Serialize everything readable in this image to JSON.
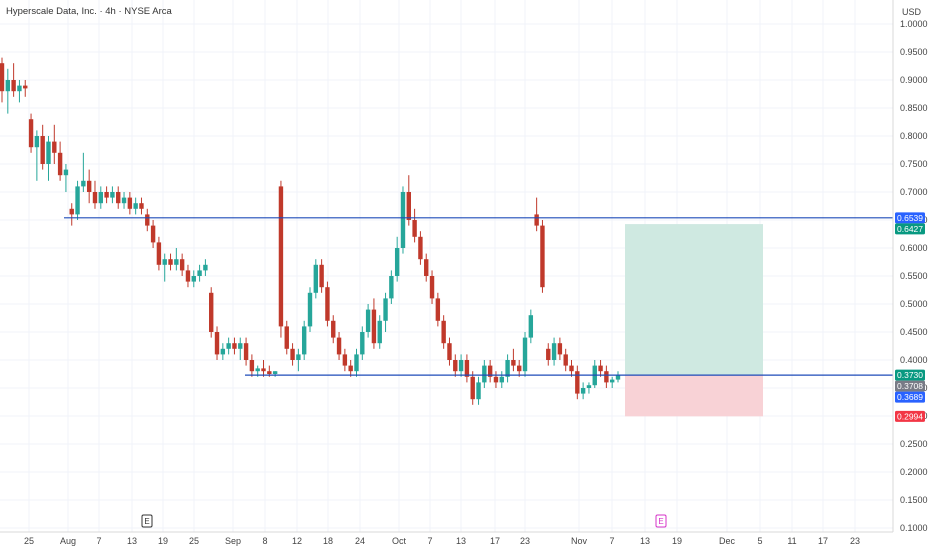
{
  "header": {
    "symbol_title": "Hyperscale Data, Inc. · 4h · NYSE Arca",
    "currency": "USD"
  },
  "colors": {
    "up": "#26a69a",
    "down": "#c0392b",
    "line": "#1e4bb8",
    "profit_zone": "#cfe9e1",
    "loss_zone": "#f8d2d6",
    "tag_green": "#089981",
    "tag_gray": "#787b86",
    "tag_blue": "#2962ff",
    "tag_red": "#f23645"
  },
  "chart_data": {
    "type": "candlestick",
    "ylim": [
      0.1,
      1.0
    ],
    "y_ticks": [
      "1.0000",
      "0.9500",
      "0.9000",
      "0.8500",
      "0.8000",
      "0.7500",
      "0.7000",
      "0.6500",
      "0.6000",
      "0.5500",
      "0.5000",
      "0.4500",
      "0.4000",
      "0.3500",
      "0.3000",
      "0.2500",
      "0.2000",
      "0.1500",
      "0.1000"
    ],
    "x_ticks": [
      "25",
      "Aug",
      "7",
      "13",
      "19",
      "25",
      "Sep",
      "8",
      "12",
      "18",
      "24",
      "Oct",
      "7",
      "13",
      "17",
      "23",
      "Nov",
      "7",
      "13",
      "19",
      "Dec",
      "5",
      "11",
      "17",
      "23"
    ],
    "horizontal_lines": [
      {
        "value": 0.6539,
        "label": "0.6539"
      },
      {
        "value": 0.373,
        "label": "0.3730"
      }
    ],
    "position": {
      "target": 0.6427,
      "entry": 0.373,
      "stop": 0.2994,
      "labels": {
        "target": "0.6427",
        "entry": "0.3730",
        "stop": "0.2994"
      }
    },
    "price_tags": [
      {
        "value": 0.6539,
        "label": "0.6539",
        "color": "tag_blue"
      },
      {
        "value": 0.6427,
        "label": "0.6427",
        "color": "tag_green"
      },
      {
        "value": 0.373,
        "label": "0.3730",
        "color": "tag_green"
      },
      {
        "value": 0.3708,
        "label": "0.3708",
        "color": "tag_gray"
      },
      {
        "value": 0.3689,
        "label": "0.3689",
        "color": "tag_blue"
      },
      {
        "value": 0.2994,
        "label": "0.2994",
        "color": "tag_red"
      }
    ],
    "events": [
      {
        "label": "E",
        "near_tick": "19",
        "style": "earnings"
      },
      {
        "label": "E",
        "near_tick": "13b",
        "style": "upcoming"
      }
    ],
    "candles": [
      [
        0.93,
        0.94,
        0.86,
        0.88
      ],
      [
        0.88,
        0.92,
        0.84,
        0.9
      ],
      [
        0.9,
        0.93,
        0.87,
        0.88
      ],
      [
        0.88,
        0.9,
        0.86,
        0.89
      ],
      [
        0.89,
        0.9,
        0.87,
        0.885
      ],
      [
        0.83,
        0.84,
        0.77,
        0.78
      ],
      [
        0.78,
        0.81,
        0.72,
        0.8
      ],
      [
        0.8,
        0.82,
        0.74,
        0.75
      ],
      [
        0.75,
        0.8,
        0.72,
        0.79
      ],
      [
        0.79,
        0.82,
        0.75,
        0.77
      ],
      [
        0.77,
        0.79,
        0.72,
        0.73
      ],
      [
        0.73,
        0.75,
        0.7,
        0.74
      ],
      [
        0.67,
        0.68,
        0.64,
        0.66
      ],
      [
        0.66,
        0.72,
        0.65,
        0.71
      ],
      [
        0.71,
        0.77,
        0.7,
        0.72
      ],
      [
        0.72,
        0.74,
        0.68,
        0.7
      ],
      [
        0.7,
        0.72,
        0.67,
        0.68
      ],
      [
        0.68,
        0.71,
        0.67,
        0.7
      ],
      [
        0.7,
        0.71,
        0.68,
        0.69
      ],
      [
        0.69,
        0.71,
        0.68,
        0.7
      ],
      [
        0.7,
        0.71,
        0.67,
        0.68
      ],
      [
        0.68,
        0.7,
        0.67,
        0.69
      ],
      [
        0.69,
        0.7,
        0.66,
        0.67
      ],
      [
        0.67,
        0.69,
        0.66,
        0.68
      ],
      [
        0.68,
        0.69,
        0.66,
        0.67
      ],
      [
        0.66,
        0.67,
        0.63,
        0.64
      ],
      [
        0.64,
        0.65,
        0.6,
        0.61
      ],
      [
        0.61,
        0.62,
        0.56,
        0.57
      ],
      [
        0.57,
        0.59,
        0.54,
        0.58
      ],
      [
        0.58,
        0.59,
        0.56,
        0.57
      ],
      [
        0.57,
        0.6,
        0.56,
        0.58
      ],
      [
        0.58,
        0.59,
        0.55,
        0.56
      ],
      [
        0.56,
        0.57,
        0.53,
        0.54
      ],
      [
        0.54,
        0.56,
        0.53,
        0.55
      ],
      [
        0.55,
        0.57,
        0.54,
        0.56
      ],
      [
        0.56,
        0.58,
        0.55,
        0.57
      ],
      [
        0.52,
        0.53,
        0.44,
        0.45
      ],
      [
        0.45,
        0.46,
        0.4,
        0.41
      ],
      [
        0.41,
        0.43,
        0.4,
        0.42
      ],
      [
        0.42,
        0.44,
        0.41,
        0.43
      ],
      [
        0.43,
        0.44,
        0.41,
        0.42
      ],
      [
        0.42,
        0.44,
        0.4,
        0.43
      ],
      [
        0.43,
        0.44,
        0.39,
        0.4
      ],
      [
        0.4,
        0.41,
        0.37,
        0.38
      ],
      [
        0.38,
        0.39,
        0.37,
        0.385
      ],
      [
        0.385,
        0.4,
        0.37,
        0.38
      ],
      [
        0.38,
        0.39,
        0.37,
        0.375
      ],
      [
        0.375,
        0.38,
        0.37,
        0.38
      ],
      [
        0.71,
        0.72,
        0.44,
        0.46
      ],
      [
        0.46,
        0.47,
        0.41,
        0.42
      ],
      [
        0.42,
        0.43,
        0.39,
        0.4
      ],
      [
        0.4,
        0.42,
        0.38,
        0.41
      ],
      [
        0.41,
        0.47,
        0.4,
        0.46
      ],
      [
        0.46,
        0.53,
        0.45,
        0.52
      ],
      [
        0.52,
        0.58,
        0.51,
        0.57
      ],
      [
        0.57,
        0.58,
        0.52,
        0.53
      ],
      [
        0.53,
        0.54,
        0.46,
        0.47
      ],
      [
        0.47,
        0.48,
        0.43,
        0.44
      ],
      [
        0.44,
        0.45,
        0.4,
        0.41
      ],
      [
        0.41,
        0.42,
        0.38,
        0.39
      ],
      [
        0.39,
        0.4,
        0.37,
        0.38
      ],
      [
        0.38,
        0.42,
        0.37,
        0.41
      ],
      [
        0.41,
        0.46,
        0.4,
        0.45
      ],
      [
        0.45,
        0.5,
        0.44,
        0.49
      ],
      [
        0.49,
        0.51,
        0.42,
        0.43
      ],
      [
        0.43,
        0.48,
        0.42,
        0.47
      ],
      [
        0.47,
        0.52,
        0.45,
        0.51
      ],
      [
        0.51,
        0.56,
        0.5,
        0.55
      ],
      [
        0.55,
        0.62,
        0.54,
        0.6
      ],
      [
        0.6,
        0.71,
        0.59,
        0.7
      ],
      [
        0.7,
        0.73,
        0.64,
        0.65
      ],
      [
        0.65,
        0.67,
        0.61,
        0.62
      ],
      [
        0.62,
        0.63,
        0.57,
        0.58
      ],
      [
        0.58,
        0.59,
        0.54,
        0.55
      ],
      [
        0.55,
        0.56,
        0.5,
        0.51
      ],
      [
        0.51,
        0.52,
        0.46,
        0.47
      ],
      [
        0.47,
        0.48,
        0.42,
        0.43
      ],
      [
        0.43,
        0.44,
        0.39,
        0.4
      ],
      [
        0.4,
        0.41,
        0.37,
        0.38
      ],
      [
        0.38,
        0.41,
        0.37,
        0.4
      ],
      [
        0.4,
        0.41,
        0.36,
        0.37
      ],
      [
        0.37,
        0.38,
        0.32,
        0.33
      ],
      [
        0.33,
        0.37,
        0.32,
        0.36
      ],
      [
        0.36,
        0.4,
        0.35,
        0.39
      ],
      [
        0.39,
        0.4,
        0.36,
        0.37
      ],
      [
        0.37,
        0.38,
        0.35,
        0.36
      ],
      [
        0.36,
        0.38,
        0.35,
        0.37
      ],
      [
        0.37,
        0.41,
        0.36,
        0.4
      ],
      [
        0.4,
        0.42,
        0.38,
        0.39
      ],
      [
        0.39,
        0.4,
        0.37,
        0.38
      ],
      [
        0.38,
        0.45,
        0.37,
        0.44
      ],
      [
        0.44,
        0.49,
        0.43,
        0.48
      ],
      [
        0.66,
        0.69,
        0.63,
        0.64
      ],
      [
        0.64,
        0.65,
        0.52,
        0.53
      ],
      [
        0.42,
        0.43,
        0.39,
        0.4
      ],
      [
        0.4,
        0.44,
        0.39,
        0.43
      ],
      [
        0.43,
        0.44,
        0.4,
        0.41
      ],
      [
        0.41,
        0.42,
        0.38,
        0.39
      ],
      [
        0.39,
        0.4,
        0.37,
        0.38
      ],
      [
        0.38,
        0.39,
        0.33,
        0.34
      ],
      [
        0.34,
        0.36,
        0.33,
        0.35
      ],
      [
        0.35,
        0.36,
        0.34,
        0.355
      ],
      [
        0.355,
        0.4,
        0.35,
        0.39
      ],
      [
        0.39,
        0.4,
        0.37,
        0.38
      ],
      [
        0.38,
        0.39,
        0.35,
        0.36
      ],
      [
        0.36,
        0.37,
        0.35,
        0.365
      ],
      [
        0.365,
        0.38,
        0.36,
        0.373
      ]
    ]
  }
}
